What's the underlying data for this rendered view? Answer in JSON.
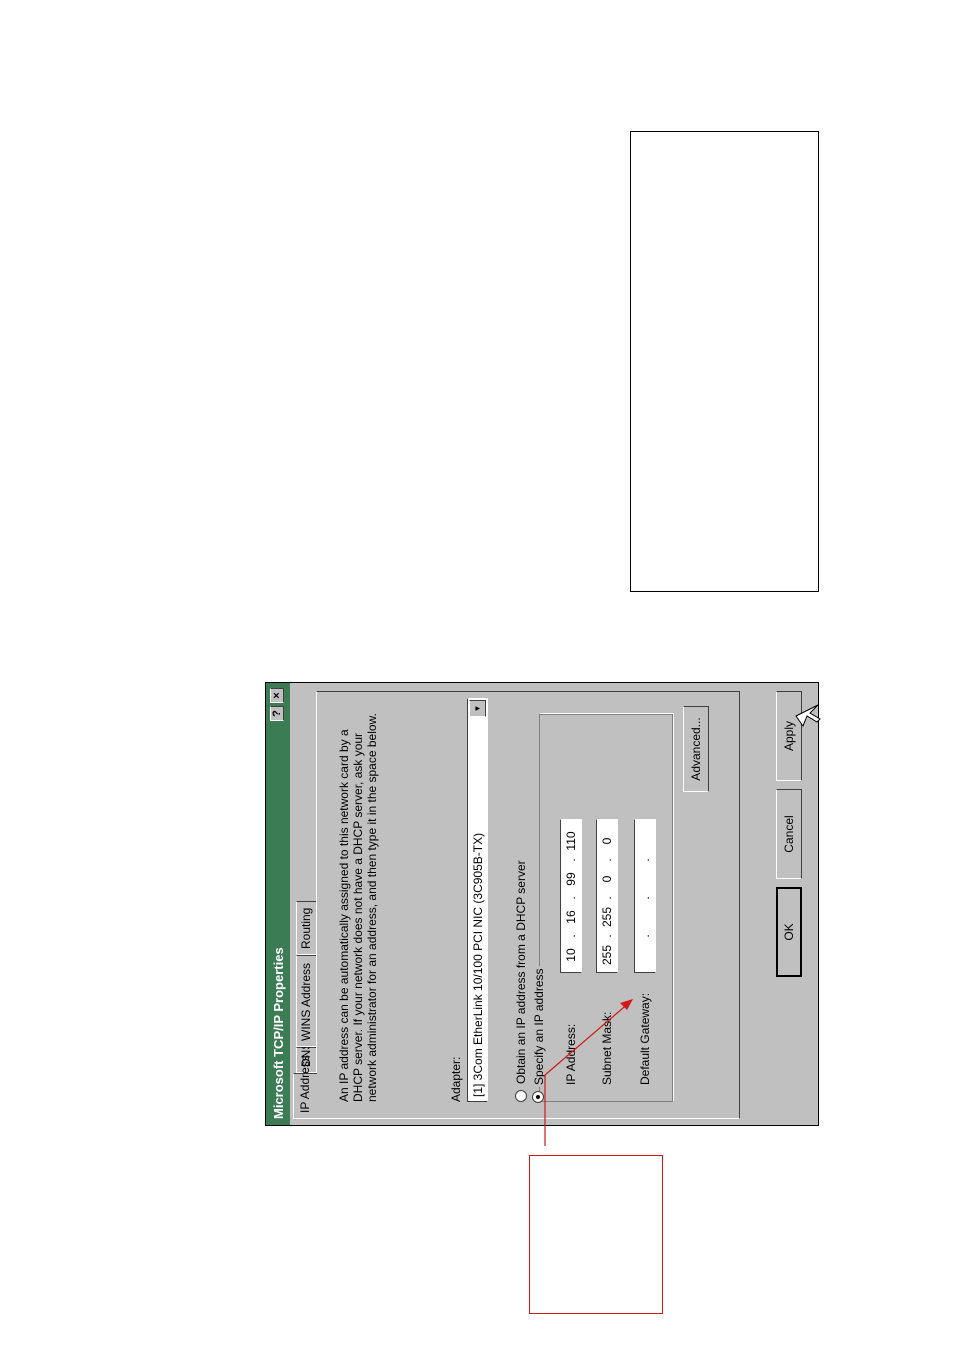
{
  "dialog": {
    "title": "Microsoft TCP/IP Properties",
    "help_button": "?",
    "close_button": "×",
    "tabs": [
      {
        "label": "IP Address"
      },
      {
        "label": "DNS"
      },
      {
        "label": "WINS Address"
      },
      {
        "label": "Routing"
      }
    ],
    "description": "An IP address can be automatically assigned to this network card by a DHCP server.  If your network does not have a DHCP server, ask your network administrator for an address, and then type it in the space below.",
    "adapter": {
      "label": "Adapter:",
      "selected": "[1] 3Com EtherLink 10/100 PCI NIC (3C905B-TX)"
    },
    "obtain_dhcp": {
      "label": "Obtain an IP address from a DHCP server",
      "selected": false
    },
    "specify_ip": {
      "label": "Specify an IP address",
      "selected": true
    },
    "ip_address": {
      "label": "IP Address:",
      "octets": [
        "10",
        "16",
        "99",
        "110"
      ]
    },
    "subnet_mask": {
      "label": "Subnet Mask:",
      "octets": [
        "255",
        "255",
        "0",
        "0"
      ]
    },
    "default_gateway": {
      "label": "Default Gateway:",
      "octets": [
        "",
        "",
        "",
        ""
      ]
    },
    "buttons": {
      "advanced": "Advanced...",
      "ok": "OK",
      "cancel": "Cancel",
      "apply": "Apply"
    }
  },
  "colors": {
    "titlebar": "#3c7c55",
    "dialog_bg": "#c0c0c0",
    "callout": "#d01818"
  }
}
